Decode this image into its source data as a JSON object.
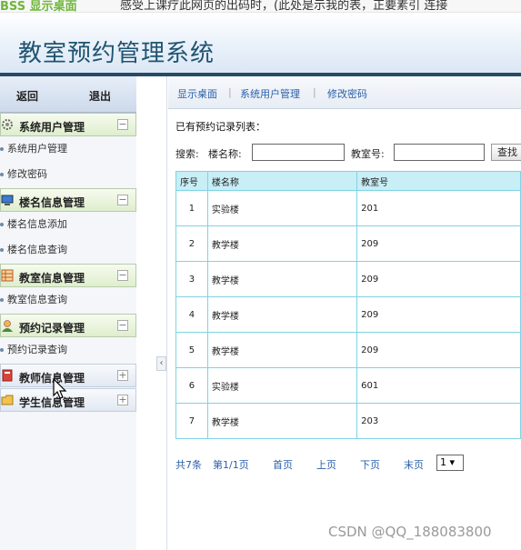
{
  "notice": {
    "leftText": "BSS 显示桌面",
    "message": "感受上课疗此网页的出码时，(此处是示我的表，正要素引 连接"
  },
  "app": {
    "title": "教室预约管理系统"
  },
  "sidebar": {
    "back": "返回",
    "logout": "退出",
    "groups": [
      {
        "label": "系统用户管理",
        "icon": "gear-icon",
        "toggle": "−",
        "items": [
          "系统用户管理",
          "修改密码"
        ]
      },
      {
        "label": "楼名信息管理",
        "icon": "monitor-icon",
        "toggle": "−",
        "items": [
          "楼名信息添加",
          "楼名信息查询"
        ]
      },
      {
        "label": "教室信息管理",
        "icon": "grid-icon",
        "toggle": "−",
        "items": [
          "教室信息查询"
        ]
      },
      {
        "label": "预约记录管理",
        "icon": "user-icon",
        "toggle": "−",
        "items": [
          "预约记录查询"
        ]
      },
      {
        "label": "教师信息管理",
        "icon": "book-icon",
        "toggle": "+",
        "items": []
      },
      {
        "label": "学生信息管理",
        "icon": "folder-icon",
        "toggle": "+",
        "items": []
      }
    ],
    "collapse": "‹"
  },
  "breadcrumb": {
    "items": [
      "显示桌面",
      "系统用户管理",
      "修改密码"
    ],
    "sep": "|"
  },
  "list": {
    "title": "已有预约记录列表：",
    "searchLabel": "搜索:",
    "buildingLabel": "楼名称:",
    "roomLabel": "教室号:",
    "searchButton": "查找",
    "buildingValue": "",
    "roomValue": ""
  },
  "table": {
    "headers": [
      "序号",
      "楼名称",
      "教室号"
    ],
    "rows": [
      [
        "1",
        "实验楼",
        "201"
      ],
      [
        "2",
        "教学楼",
        "209"
      ],
      [
        "3",
        "教学楼",
        "209"
      ],
      [
        "4",
        "教学楼",
        "209"
      ],
      [
        "5",
        "教学楼",
        "209"
      ],
      [
        "6",
        "实验楼",
        "601"
      ],
      [
        "7",
        "教学楼",
        "203"
      ]
    ]
  },
  "pager": {
    "total": "共7条",
    "page": "第1/1页",
    "first": "首页",
    "prev": "上页",
    "next": "下页",
    "last": "末页",
    "selected": "1 ▾"
  },
  "watermark": "CSDN @QQ_188083800"
}
